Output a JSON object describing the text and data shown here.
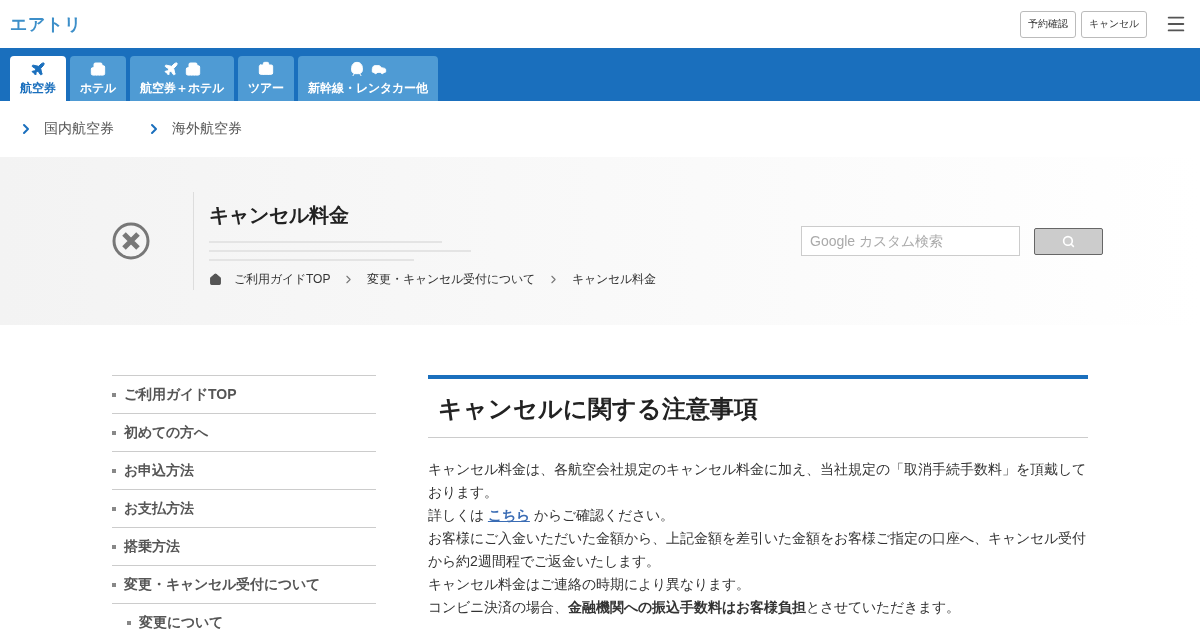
{
  "header": {
    "logo": "エアトリ",
    "buttons": [
      "予約確認",
      "キャンセル"
    ]
  },
  "tabs": [
    {
      "label": "航空券",
      "kind": "air",
      "selected": true
    },
    {
      "label": "ホテル",
      "kind": "hotel",
      "selected": false
    },
    {
      "label": "航空券＋ホテル",
      "kind": "air_hotel",
      "selected": false
    },
    {
      "label": "ツアー",
      "kind": "tour",
      "selected": false
    },
    {
      "label": "新幹線・レンタカー他",
      "kind": "other",
      "selected": false
    }
  ],
  "sub_nav": [
    "国内航空券",
    "海外航空券"
  ],
  "hero": {
    "title": "キャンセル料金",
    "breadcrumb": [
      "ご利用ガイドTOP",
      "変更・キャンセル受付について",
      "キャンセル料金"
    ],
    "search": {
      "placeholder": "Google カスタム検索"
    }
  },
  "sidebar": {
    "items": [
      {
        "label": "ご利用ガイドTOP",
        "kind": "top"
      },
      {
        "label": "初めての方へ",
        "kind": "top"
      },
      {
        "label": "お申込方法",
        "kind": "top"
      },
      {
        "label": "お支払方法",
        "kind": "top"
      },
      {
        "label": "搭乗方法",
        "kind": "top"
      },
      {
        "label": "変更・キャンセル受付について",
        "kind": "top"
      },
      {
        "label": "変更について",
        "kind": "sub"
      }
    ]
  },
  "article": {
    "heading": "キャンセルに関する注意事項",
    "paragraphs": [
      {
        "text": "キャンセル料金は、各航空会社規定のキャンセル料金に加え、当社規定の「取消手続手数料」を頂戴しております。"
      },
      {
        "before": "詳しくは ",
        "link": "こちら",
        "after": " からご確認ください。"
      },
      {
        "text": "お客様にご入金いただいた金額から、上記金額を差引いた金額をお客様ご指定の口座へ、キャンセル受付から約2週間程でご返金いたします。"
      },
      {
        "text": "キャンセル料金はご連絡の時期により異なります。"
      },
      {
        "text": "コンビニ決済の場合、**金融機関への振込手数料はお客様負担**とさせていただきます。"
      }
    ]
  }
}
